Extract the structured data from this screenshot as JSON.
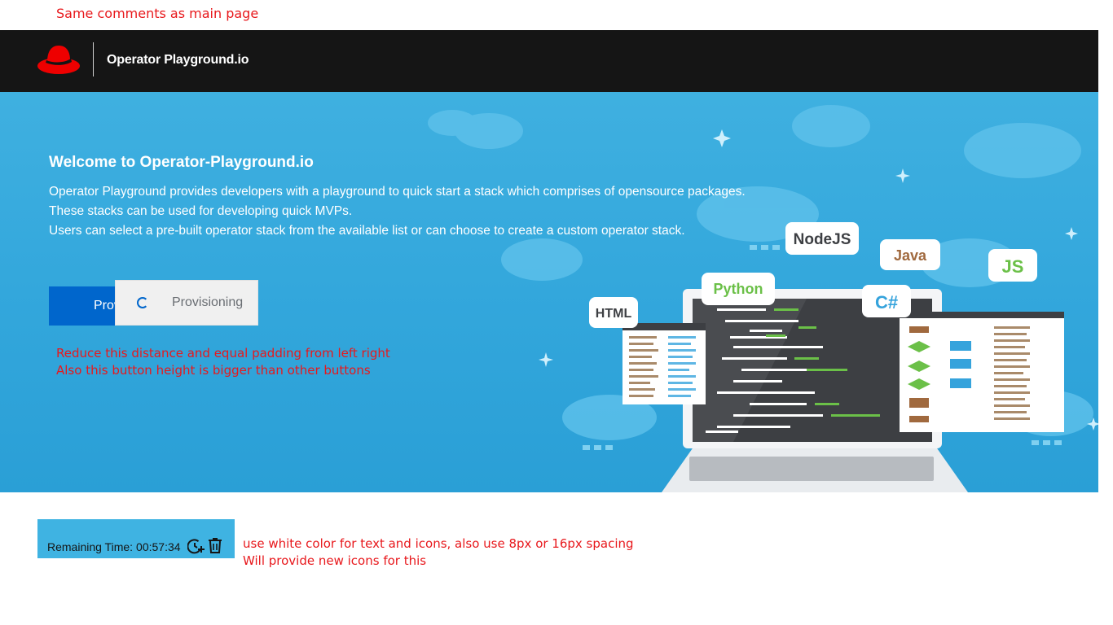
{
  "annotations": {
    "top": "Same comments as main page",
    "button_line1": "Reduce this distance and equal padding from left right",
    "button_line2": "Also this button height is bigger than other buttons",
    "timer_line1": "use white color for text and icons, also use 8px or 16px spacing",
    "timer_line2": "Will provide new icons for this",
    "color": "#e8181c"
  },
  "masthead": {
    "brand": "Operator Playground.io",
    "logo_icon": "redhat-hat-icon",
    "background": "#151515"
  },
  "hero": {
    "title": "Welcome to Operator-Playground.io",
    "lines": [
      "Operator Playground provides developers with a playground to quick start a stack which comprises of opensource packages.",
      "These stacks can be used for developing quick MVPs.",
      "Users can select a pre-built operator stack from the available list or can choose to create a custom operator stack."
    ],
    "primary_button_label": "Provision",
    "provisioning_label": "Provisioning",
    "background": "#33a7dc",
    "tech_tags": [
      "NodeJS",
      "Java",
      "JS",
      "Python",
      "C#",
      "HTML"
    ]
  },
  "timer": {
    "label": "Remaining Time:",
    "value": "00:57:34",
    "extend_icon": "clock-plus-icon",
    "delete_icon": "trash-icon",
    "background": "#3fb3e2"
  }
}
